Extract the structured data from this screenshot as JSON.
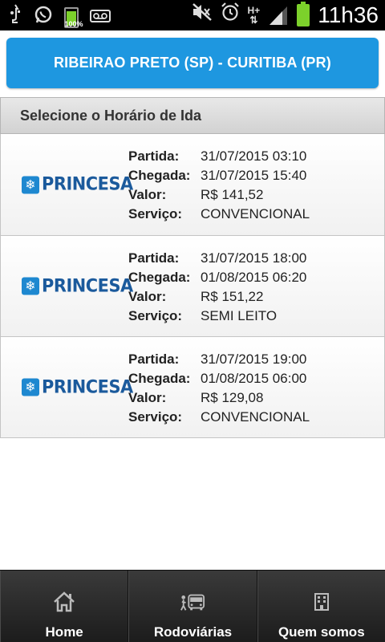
{
  "status_bar": {
    "battery_small_percent": "100%",
    "network": "H+",
    "time": "11h36",
    "icons": [
      "usb-icon",
      "whatsapp-icon",
      "battery-icon",
      "voicemail-icon",
      "mute-icon",
      "alarm-icon",
      "network-icon",
      "signal-icon",
      "battery-icon"
    ]
  },
  "route": {
    "title": "RIBEIRAO PRETO (SP) - CURITIBA (PR)"
  },
  "section": {
    "title": "Selecione o Horário de Ida"
  },
  "labels": {
    "partida": "Partida:",
    "chegada": "Chegada:",
    "valor": "Valor:",
    "servico": "Serviço:"
  },
  "trips": [
    {
      "company": "PRINCESA",
      "partida": "31/07/2015 03:10",
      "chegada": "31/07/2015 15:40",
      "valor": "R$ 141,52",
      "servico": "CONVENCIONAL"
    },
    {
      "company": "PRINCESA",
      "partida": "31/07/2015 18:00",
      "chegada": "01/08/2015 06:20",
      "valor": "R$ 151,22",
      "servico": "SEMI LEITO"
    },
    {
      "company": "PRINCESA",
      "partida": "31/07/2015 19:00",
      "chegada": "01/08/2015 06:00",
      "valor": "R$ 129,08",
      "servico": "CONVENCIONAL"
    }
  ],
  "nav": {
    "home": "Home",
    "rodoviarias": "Rodoviárias",
    "quem_somos": "Quem somos"
  },
  "colors": {
    "accent": "#1e97e0",
    "battery": "#7cd12b",
    "logo": "#1b5a9c"
  }
}
